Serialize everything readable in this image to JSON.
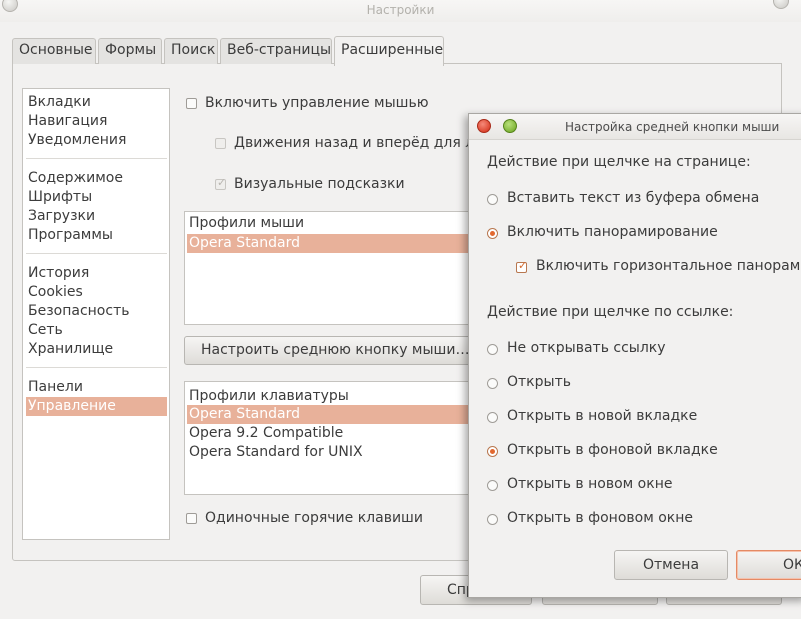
{
  "window": {
    "title": "Настройки"
  },
  "tabs": [
    {
      "label": "Основные"
    },
    {
      "label": "Формы"
    },
    {
      "label": "Поиск"
    },
    {
      "label": "Веб-страницы"
    },
    {
      "label": "Расширенные",
      "active": true
    }
  ],
  "sidebar": {
    "groups": [
      [
        "Вкладки",
        "Навигация",
        "Уведомления"
      ],
      [
        "Содержимое",
        "Шрифты",
        "Загрузки",
        "Программы"
      ],
      [
        "История",
        "Cookies",
        "Безопасность",
        "Сеть",
        "Хранилище"
      ],
      [
        "Панели",
        "Управление"
      ]
    ],
    "selected": "Управление"
  },
  "controls": {
    "mouse_gestures": {
      "label": "Включить управление мышью",
      "checked": false
    },
    "back_forward": {
      "label": "Движения назад и вперёд для ле",
      "checked": false,
      "disabled": true
    },
    "visual_hints": {
      "label": "Визуальные подсказки",
      "checked": true,
      "disabled": true
    },
    "mouse_profiles": {
      "header": "Профили мыши",
      "items": [
        "Opera Standard"
      ],
      "selected": "Opera Standard"
    },
    "configure_middle_button": "Настроить среднюю кнопку мыши…",
    "keyboard_profiles": {
      "header": "Профили клавиатуры",
      "items": [
        "Opera Standard",
        "Opera 9.2 Compatible",
        "Opera Standard for UNIX"
      ],
      "selected": "Opera Standard"
    },
    "single_key_shortcuts": {
      "label": "Одиночные горячие клавиши",
      "checked": false
    }
  },
  "bottom_buttons": {
    "help": "Спр"
  },
  "dialog": {
    "title": "Настройка средней кнопки мыши",
    "page_section": {
      "heading": "Действие при щелчке на странице:",
      "options": [
        {
          "label": "Вставить текст из буфера обмена",
          "selected": false
        },
        {
          "label": "Включить панорамирование",
          "selected": true
        }
      ],
      "horizontal_panning": {
        "label": "Включить горизонтальное панорами",
        "checked": true
      }
    },
    "link_section": {
      "heading": "Действие при щелчке по ссылке:",
      "options": [
        {
          "label": "Не открывать ссылку",
          "selected": false
        },
        {
          "label": "Открыть",
          "selected": false
        },
        {
          "label": "Открыть в новой вкладке",
          "selected": false
        },
        {
          "label": "Открыть в фоновой вкладке",
          "selected": true
        },
        {
          "label": "Открыть в новом окне",
          "selected": false
        },
        {
          "label": "Открыть в фоновом окне",
          "selected": false
        }
      ]
    },
    "buttons": {
      "cancel": "Отмена",
      "ok": "ОК"
    }
  },
  "colors": {
    "selection": "#e8b19a",
    "accent": "#e2682f"
  }
}
